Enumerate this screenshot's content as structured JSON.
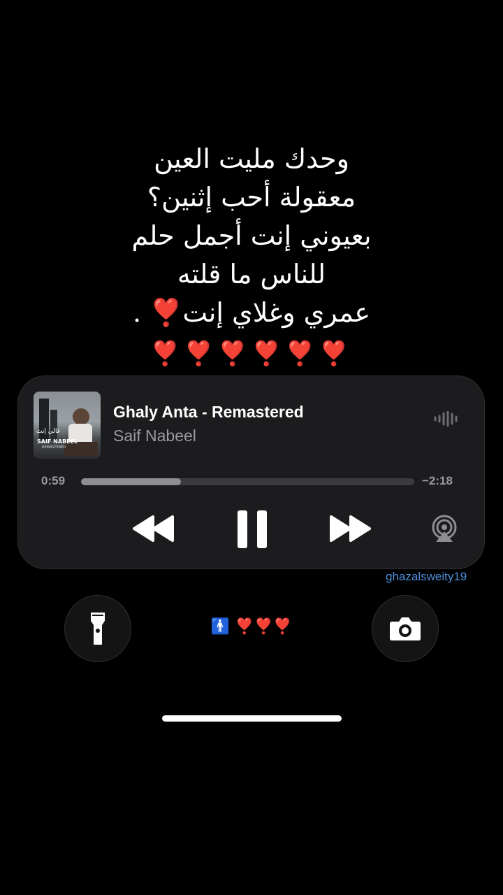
{
  "lyrics": {
    "line1": "وحدك مليت العين",
    "line2": "معقولة أحب إثنين؟",
    "line3": "بعيوني إنت أجمل حلم",
    "line4": "للناس ما قلته",
    "line5": "عمري وغلاي إنت❣️ ."
  },
  "hearts": "❣️❣️❣️❣️❣️❣️",
  "now_playing": {
    "title": "Ghaly Anta - Remastered",
    "artist": "Saif Nabeel",
    "elapsed": "0:59",
    "remaining": "−2:18",
    "progress": 0.3,
    "artwork": {
      "title_text": "غالي إنت",
      "artist_text": "SAIF NABEEL",
      "sub_text": "REMASTERED"
    }
  },
  "icons": {
    "wave": "waveform-icon",
    "rewind": "rewind-icon",
    "pause": "pause-icon",
    "forward": "fast-forward-icon",
    "airplay": "airplay-icon",
    "flashlight": "flashlight-icon",
    "camera": "camera-icon"
  },
  "watermark": "ghazalsweity19",
  "bottom_emoji": {
    "person": "🚹",
    "hearts": "❣️❣️❣️"
  },
  "colors": {
    "background": "#000000",
    "player_bg": "#1c1c1e",
    "accent_heart": "#e0142b",
    "watermark": "#4a8fd9"
  }
}
